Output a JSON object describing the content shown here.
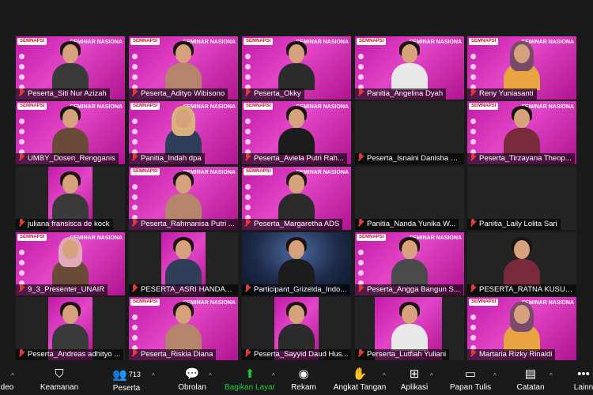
{
  "participants": [
    {
      "name": "Peserta_Siti Nur Azizah",
      "bg": "slide"
    },
    {
      "name": "Peserta_Adityo Wibisono",
      "bg": "slide"
    },
    {
      "name": "Peserta_Okky",
      "bg": "slide"
    },
    {
      "name": "Panitia_Angelina Dyah",
      "bg": "slide"
    },
    {
      "name": "Reny Yuniasanti",
      "bg": "slide"
    },
    {
      "name": "UMBY_Dosen_Rengganis",
      "bg": "slide"
    },
    {
      "name": "Panitia_Indah dpa",
      "bg": "slide"
    },
    {
      "name": "Peserta_Aviela Putri Rah...",
      "bg": "slide"
    },
    {
      "name": "Peserta_Isnaini Danisha C...",
      "bg": "dark"
    },
    {
      "name": "Peserta_Tirzayana Theop...",
      "bg": "slide"
    },
    {
      "name": "juliana fransisca de kock",
      "bg": "slide-sq"
    },
    {
      "name": "Peserta_Rahmanisa Putri ...",
      "bg": "slide"
    },
    {
      "name": "Peserta_Margaretha ADS",
      "bg": "slide"
    },
    {
      "name": "Panitia_Nanda Yunika W...",
      "bg": "dark"
    },
    {
      "name": "Panitia_Laily Lolita Sari",
      "bg": "dark"
    },
    {
      "name": "9_3_Presenter_UNAIR",
      "bg": "slide"
    },
    {
      "name": "PESERTA_ASRI HANDAYANI",
      "bg": "slide-sq"
    },
    {
      "name": "Participant_Grizelda_Indo...",
      "bg": "photo"
    },
    {
      "name": "Peserta_Angga Bangun S...",
      "bg": "slide"
    },
    {
      "name": "PESERTA_RATNA KUSUMA",
      "bg": "dark"
    },
    {
      "name": "Peserta_Andreas adhityo ...",
      "bg": "slide-sq"
    },
    {
      "name": "Peserta_Riskia Diana",
      "bg": "slide"
    },
    {
      "name": "Peserta_Sayyid Daud Hus...",
      "bg": "slide-sq"
    },
    {
      "name": "Perserta_Lutfiah Yuliani",
      "bg": "slide-sq2"
    },
    {
      "name": "Martaria Rizky Rinaldi",
      "bg": "slide"
    }
  ],
  "slide": {
    "logo": "SEMNAPSI",
    "banner": "SEMINAR NASIONA"
  },
  "toolbar": {
    "left_partial": "deo",
    "security": "Keamanan",
    "participants": "Peserta",
    "participants_count": "713",
    "chat": "Obrolan",
    "share": "Bagikan Layar",
    "record": "Rekam",
    "raise_hand": "Angkat Tangan",
    "apps": "Aplikasi",
    "whiteboard": "Papan Tulis",
    "notes": "Catatan",
    "more": "Lainn"
  },
  "colors": {
    "accent_share": "#1ec940",
    "mic_muted": "#e03a3a",
    "slide": "#d12fb4"
  }
}
